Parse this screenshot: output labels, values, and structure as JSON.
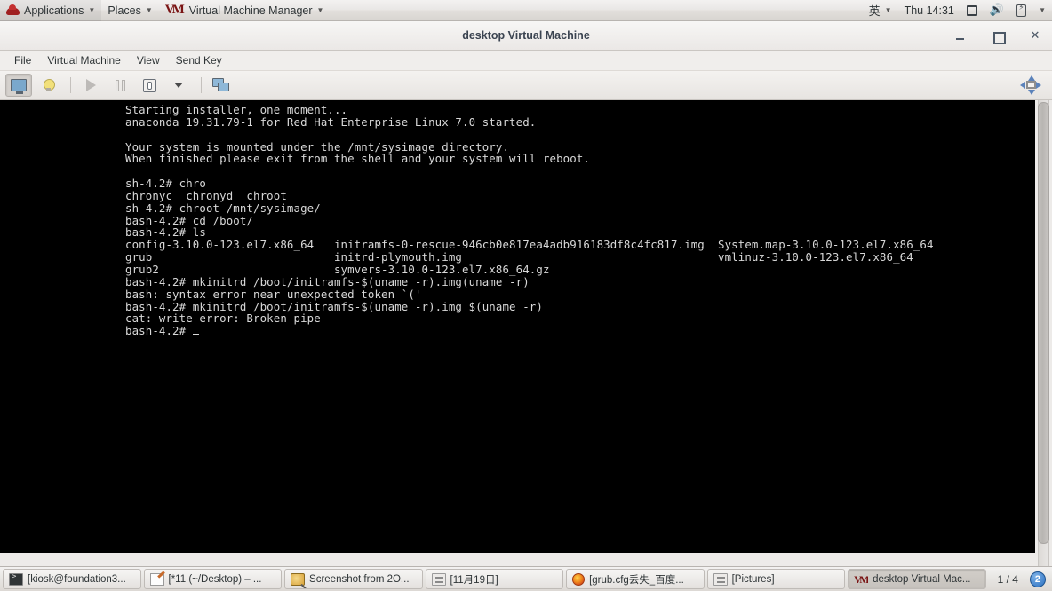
{
  "top_panel": {
    "applications_label": "Applications",
    "places_label": "Places",
    "app_menu_label": "Virtual Machine Manager",
    "logo_icon": "redhat-logo-icon",
    "app_logo_icon": "virtual-machine-manager-logo-icon",
    "ime_label": "英",
    "clock_label": "Thu 14:31",
    "tray": {
      "display_icon": "display-icon",
      "volume_icon": "speaker-icon",
      "battery_icon": "battery-icon",
      "caret_icon": "chevron-down-icon"
    }
  },
  "window": {
    "title": "desktop Virtual Machine",
    "controls": {
      "minimize": "minimize-icon",
      "maximize": "maximize-icon",
      "close": "✕"
    }
  },
  "menubar": {
    "items": [
      {
        "label": "File"
      },
      {
        "label": "Virtual Machine"
      },
      {
        "label": "View"
      },
      {
        "label": "Send Key"
      }
    ]
  },
  "toolbar": {
    "buttons": [
      {
        "name": "show-console-button",
        "icon": "monitor-icon",
        "active": true
      },
      {
        "name": "show-details-button",
        "icon": "lightbulb-icon",
        "active": false
      },
      {
        "name": "run-button",
        "icon": "play-icon",
        "active": false
      },
      {
        "name": "pause-button",
        "icon": "pause-icon",
        "active": false
      },
      {
        "name": "shutdown-button",
        "icon": "power-switch-icon",
        "active": false
      },
      {
        "name": "shutdown-menu-button",
        "icon": "chevron-down-icon",
        "active": false
      },
      {
        "name": "snapshots-button",
        "icon": "screens-icon",
        "active": false
      }
    ],
    "fullscreen_icon": "fullscreen-expand-icon"
  },
  "terminal": {
    "lines": [
      "Starting installer, one moment...",
      "anaconda 19.31.79-1 for Red Hat Enterprise Linux 7.0 started.",
      "",
      "Your system is mounted under the /mnt/sysimage directory.",
      "When finished please exit from the shell and your system will reboot.",
      "",
      "sh-4.2# chro",
      "chronyc  chronyd  chroot",
      "sh-4.2# chroot /mnt/sysimage/",
      "bash-4.2# cd /boot/",
      "bash-4.2# ls",
      "config-3.10.0-123.el7.x86_64   initramfs-0-rescue-946cb0e817ea4adb916183df8c4fc817.img  System.map-3.10.0-123.el7.x86_64",
      "grub                           initrd-plymouth.img                                      vmlinuz-3.10.0-123.el7.x86_64",
      "grub2                          symvers-3.10.0-123.el7.x86_64.gz",
      "bash-4.2# mkinitrd /boot/initramfs-$(uname -r).img(uname -r)",
      "bash: syntax error near unexpected token `('",
      "bash-4.2# mkinitrd /boot/initramfs-$(uname -r).img $(uname -r)",
      "cat: write error: Broken pipe"
    ],
    "prompt": "bash-4.2# ",
    "cursor": "_",
    "background": "#000000",
    "foreground": "#d8d8d8"
  },
  "taskbar": {
    "tasks": [
      {
        "label": "[kiosk@foundation3...",
        "icon": "terminal-icon",
        "active": false
      },
      {
        "label": "[*11 (~/Desktop) – ...",
        "icon": "text-editor-icon",
        "active": false
      },
      {
        "label": "Screenshot from 2O...",
        "icon": "screenshot-icon",
        "active": false
      },
      {
        "label": "[11月19日]",
        "icon": "window-icon",
        "active": false
      },
      {
        "label": "[grub.cfg丢失_百度...",
        "icon": "firefox-icon",
        "active": false
      },
      {
        "label": "[Pictures]",
        "icon": "window-icon",
        "active": false
      },
      {
        "label": "desktop Virtual Mac...",
        "icon": "virtual-machine-manager-logo-icon",
        "active": true
      }
    ],
    "workspace_label": "1 / 4",
    "notification_count": "2"
  }
}
